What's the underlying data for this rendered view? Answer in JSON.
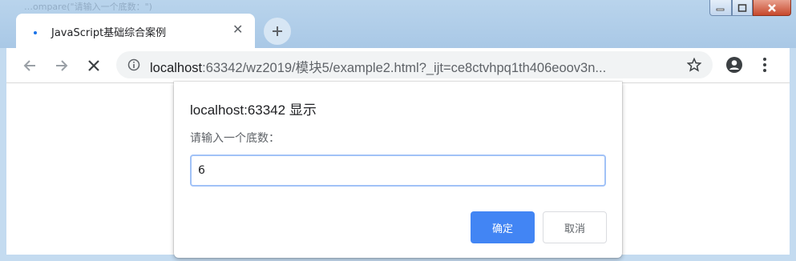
{
  "window": {
    "ghost_title": "…ompare(\"请输入一个底数：\")"
  },
  "tab": {
    "title": "JavaScript基础综合案例"
  },
  "toolbar": {
    "url_host": "localhost",
    "url_rest": ":63342/wz2019/模块5/example2.html?_ijt=ce8ctvhpq1th406eoov3n..."
  },
  "dialog": {
    "title": "localhost:63342 显示",
    "message": "请输入一个底数：",
    "input_value": "6",
    "ok_label": "确定",
    "cancel_label": "取消"
  },
  "colors": {
    "accent": "#4285f4",
    "input_focus": "#a1c2f7"
  }
}
